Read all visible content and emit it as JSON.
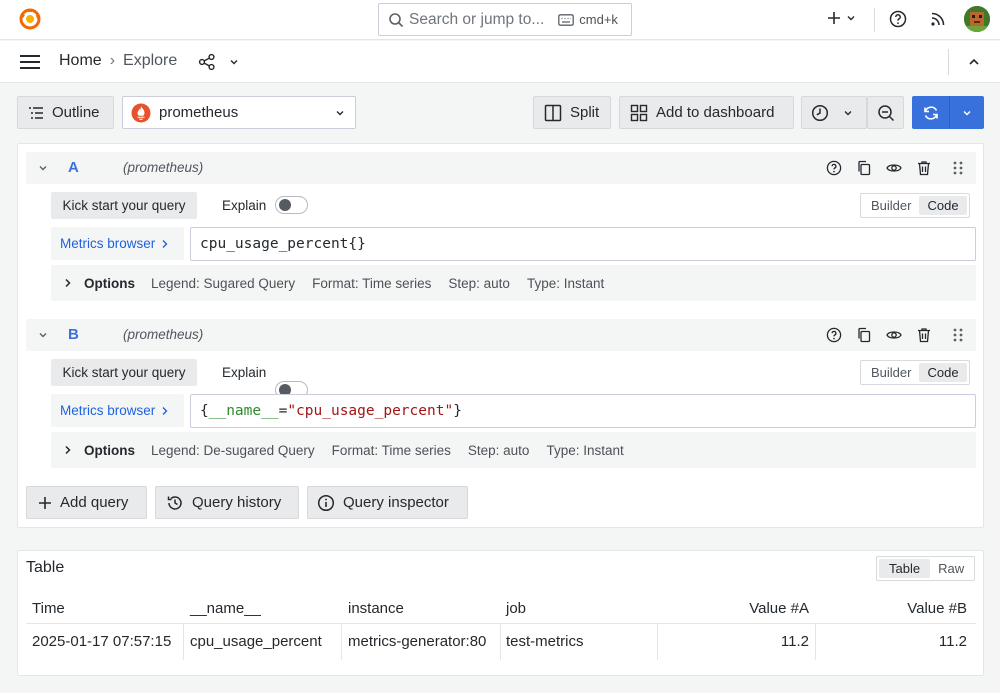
{
  "topbar": {
    "search_placeholder": "Search or jump to...",
    "search_shortcut": "cmd+k"
  },
  "navbar": {
    "breadcrumb_home": "Home",
    "breadcrumb_separator": "›",
    "breadcrumb_current": "Explore"
  },
  "toolbar": {
    "outline_label": "Outline",
    "datasource": "prometheus",
    "split_label": "Split",
    "add_dashboard_label": "Add to dashboard"
  },
  "queries": [
    {
      "letter": "A",
      "datasource": "(prometheus)",
      "kick_start": "Kick start your query",
      "explain": "Explain",
      "builder": "Builder",
      "code": "Code",
      "metrics_browser": "Metrics browser",
      "expr": "cpu_usage_percent{}",
      "options_label": "Options",
      "legend": "Legend: Sugared Query",
      "format": "Format: Time series",
      "step": "Step: auto",
      "type": "Type: Instant"
    },
    {
      "letter": "B",
      "datasource": "(prometheus)",
      "kick_start": "Kick start your query",
      "explain": "Explain",
      "builder": "Builder",
      "code": "Code",
      "metrics_browser": "Metrics browser",
      "expr_open": "{",
      "expr_key": "__name__",
      "expr_eq": "=",
      "expr_val": "\"cpu_usage_percent\"",
      "expr_close": "}",
      "options_label": "Options",
      "legend": "Legend: De-sugared Query",
      "format": "Format: Time series",
      "step": "Step: auto",
      "type": "Type: Instant"
    }
  ],
  "actions": {
    "add_query": "Add query",
    "query_history": "Query history",
    "query_inspector": "Query inspector"
  },
  "results": {
    "title": "Table",
    "toggle_table": "Table",
    "toggle_raw": "Raw",
    "columns": [
      "Time",
      "__name__",
      "instance",
      "job",
      "Value #A",
      "Value #B"
    ],
    "rows": [
      [
        "2025-01-17 07:57:15",
        "cpu_usage_percent",
        "metrics-generator:80",
        "test-metrics",
        "11.2",
        "11.2"
      ]
    ]
  },
  "colors": {
    "accent_blue": "#3d71d9",
    "run_blue": "#3871dc",
    "link_blue": "#1f62e0",
    "grafana_orange": "#f46800",
    "prometheus_red": "#e6522c",
    "string_red": "#a31515",
    "key_green": "#2f8a2f"
  }
}
